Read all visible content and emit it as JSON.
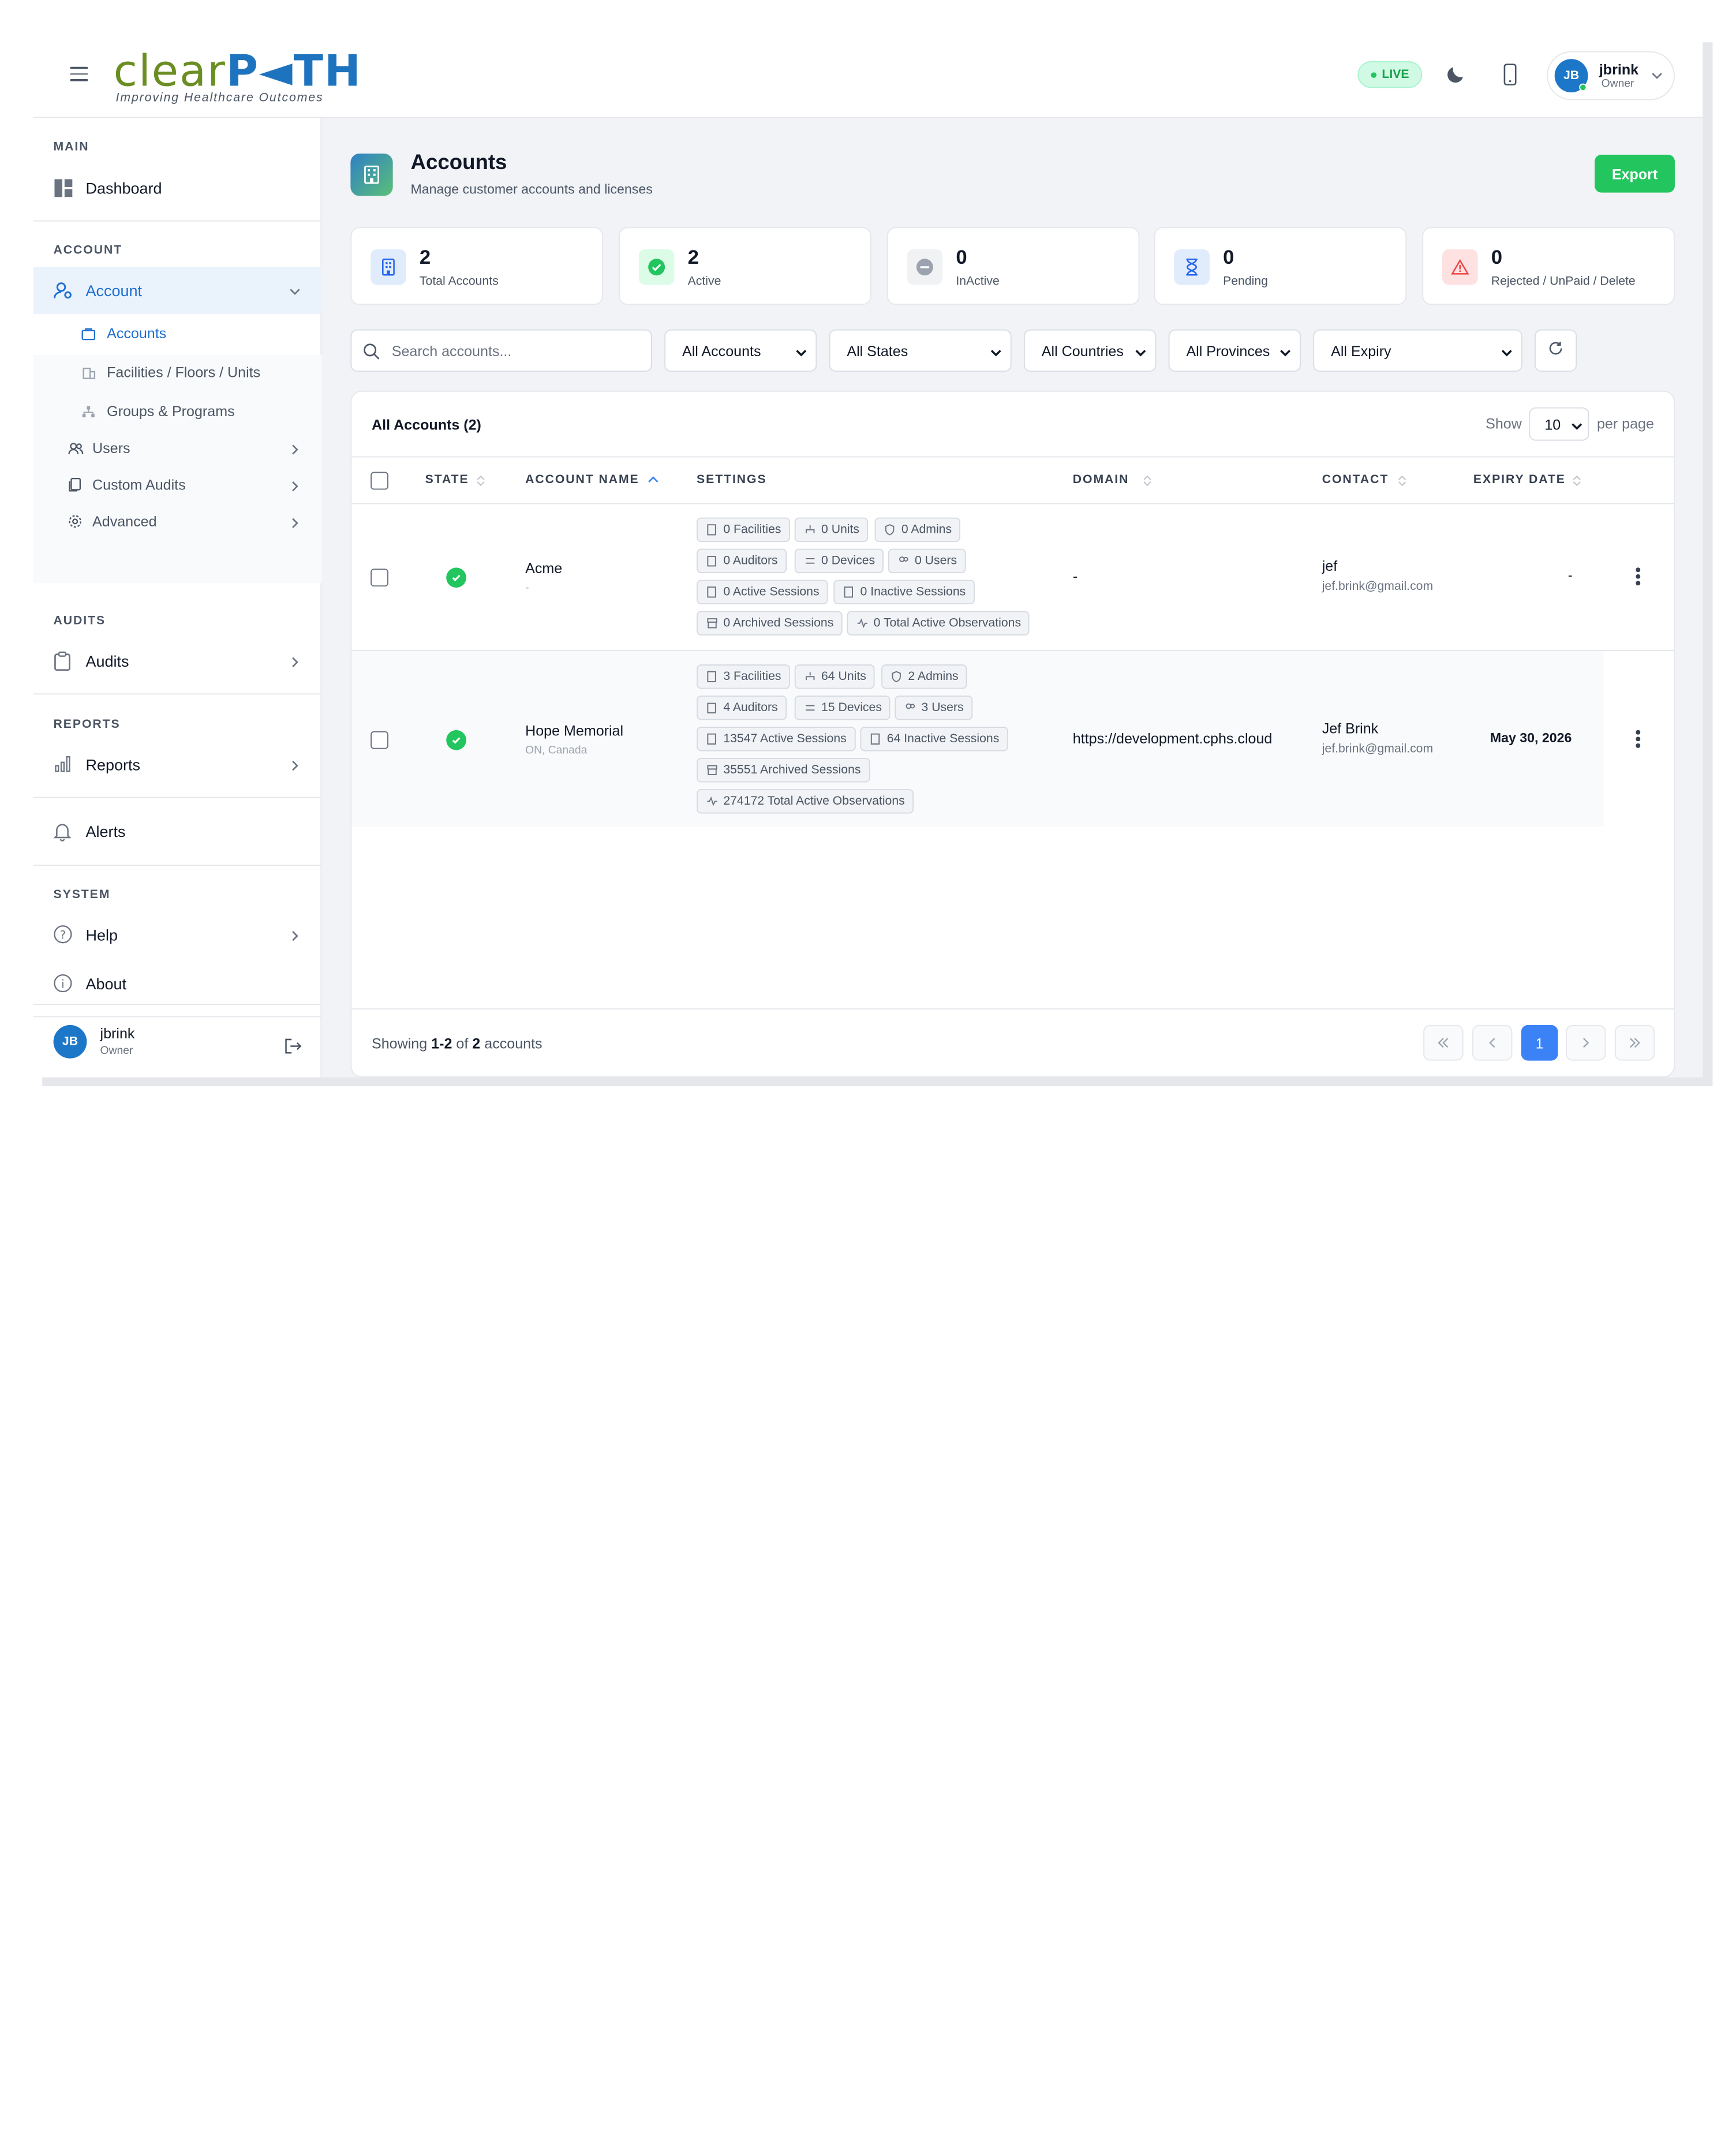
{
  "header": {
    "logo_part1": "clear",
    "logo_part2": "P◄TH",
    "logo_tagline": "Improving Healthcare Outcomes",
    "live_label": "LIVE",
    "user": {
      "initials": "JB",
      "name": "jbrink",
      "role": "Owner"
    }
  },
  "sidebar": {
    "main_label": "MAIN",
    "dashboard": "Dashboard",
    "account_label": "ACCOUNT",
    "account": "Account",
    "sub_accounts": "Accounts",
    "sub_facilities": "Facilities / Floors / Units",
    "sub_groups": "Groups & Programs",
    "users": "Users",
    "custom_audits": "Custom Audits",
    "advanced": "Advanced",
    "audits_label": "AUDITS",
    "audits": "Audits",
    "reports_label": "REPORTS",
    "reports": "Reports",
    "alerts": "Alerts",
    "system_label": "SYSTEM",
    "help": "Help",
    "about": "About",
    "footer_user": {
      "initials": "JB",
      "name": "jbrink",
      "role": "Owner"
    }
  },
  "page": {
    "title": "Accounts",
    "subtitle": "Manage customer accounts and licenses",
    "export": "Export"
  },
  "stats": [
    {
      "value": "2",
      "label": "Total Accounts",
      "color": "#2563eb"
    },
    {
      "value": "2",
      "label": "Active",
      "color": "#22c55e"
    },
    {
      "value": "0",
      "label": "InActive",
      "color": "#6b7280"
    },
    {
      "value": "0",
      "label": "Pending",
      "color": "#2563eb"
    },
    {
      "value": "0",
      "label": "Rejected / UnPaid / Delete",
      "color": "#ef4444"
    }
  ],
  "filters": {
    "search_placeholder": "Search accounts...",
    "accounts": "All Accounts",
    "states": "All States",
    "countries": "All Countries",
    "provinces": "All Provinces",
    "expiry": "All Expiry"
  },
  "table": {
    "title": "All Accounts (2)",
    "show": "Show",
    "per_page_value": "10",
    "per_page": "per page",
    "columns": {
      "state": "STATE",
      "name": "ACCOUNT NAME",
      "settings": "SETTINGS",
      "domain": "DOMAIN",
      "contact": "CONTACT",
      "expiry": "EXPIRY DATE"
    },
    "rows": [
      {
        "name": "Acme",
        "location": "-",
        "chips": [
          "0 Facilities",
          "0 Units",
          "0 Admins",
          "0 Auditors",
          "0 Devices",
          "0 Users",
          "0 Active Sessions",
          "0 Inactive Sessions",
          "0 Archived Sessions",
          "0 Total Active Observations"
        ],
        "domain": "-",
        "contact_name": "jef",
        "contact_email": "jef.brink@gmail.com",
        "expiry": "-"
      },
      {
        "name": "Hope Memorial",
        "location": "ON, Canada",
        "chips": [
          "3 Facilities",
          "64 Units",
          "2 Admins",
          "4 Auditors",
          "15 Devices",
          "3 Users",
          "13547 Active Sessions",
          "64 Inactive Sessions",
          "35551 Archived Sessions",
          "274172 Total Active Observations"
        ],
        "domain": "https://development.cphs.cloud",
        "contact_name": "Jef Brink",
        "contact_email": "jef.brink@gmail.com",
        "expiry": "May 30, 2026"
      }
    ],
    "footer": {
      "showing": "Showing",
      "range": "1-2",
      "of": "of",
      "total": "2",
      "unit": "accounts"
    },
    "pagination": {
      "current": "1"
    }
  }
}
